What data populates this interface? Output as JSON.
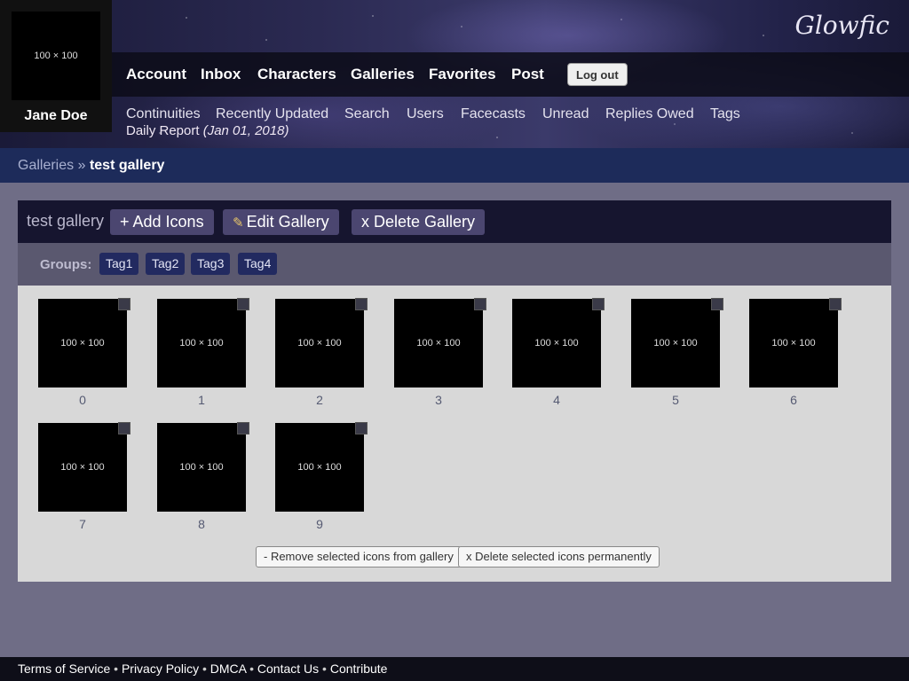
{
  "user": {
    "avatar_placeholder": "100 × 100",
    "name": "Jane Doe"
  },
  "logo": "Glowfic",
  "main_nav": [
    "Account",
    "Inbox",
    "Characters",
    "Galleries",
    "Favorites",
    "Post"
  ],
  "logout_label": "Log out",
  "sub_nav": [
    "Continuities",
    "Recently Updated",
    "Search",
    "Users",
    "Facecasts",
    "Unread",
    "Replies Owed",
    "Tags"
  ],
  "daily_report": {
    "label": "Daily Report",
    "date": "(Jan 01, 2018)"
  },
  "breadcrumb": {
    "parent": "Galleries",
    "separator": "»",
    "current": "test gallery"
  },
  "gallery": {
    "title": "test gallery",
    "add_icons": "+ Add Icons",
    "edit_gallery": "Edit Gallery",
    "delete_gallery": "x Delete Gallery",
    "groups_label": "Groups:",
    "tags": [
      "Tag1",
      "Tag2",
      "Tag3",
      "Tag4"
    ],
    "icons": [
      {
        "label": "0",
        "placeholder": "100 × 100"
      },
      {
        "label": "1",
        "placeholder": "100 × 100"
      },
      {
        "label": "2",
        "placeholder": "100 × 100"
      },
      {
        "label": "3",
        "placeholder": "100 × 100"
      },
      {
        "label": "4",
        "placeholder": "100 × 100"
      },
      {
        "label": "5",
        "placeholder": "100 × 100"
      },
      {
        "label": "6",
        "placeholder": "100 × 100"
      },
      {
        "label": "7",
        "placeholder": "100 × 100"
      },
      {
        "label": "8",
        "placeholder": "100 × 100"
      },
      {
        "label": "9",
        "placeholder": "100 × 100"
      }
    ],
    "remove_selected": "- Remove selected icons from gallery",
    "delete_selected": "x Delete selected icons permanently"
  },
  "footer": [
    "Terms of Service",
    "Privacy Policy",
    "DMCA",
    "Contact Us",
    "Contribute"
  ],
  "footer_separator": "•",
  "colors": {
    "breadcrumb_bg": "#1d2b5a",
    "header_bar": "#16152f",
    "tag_bg": "#222a60",
    "button_bg": "#4b4670"
  }
}
